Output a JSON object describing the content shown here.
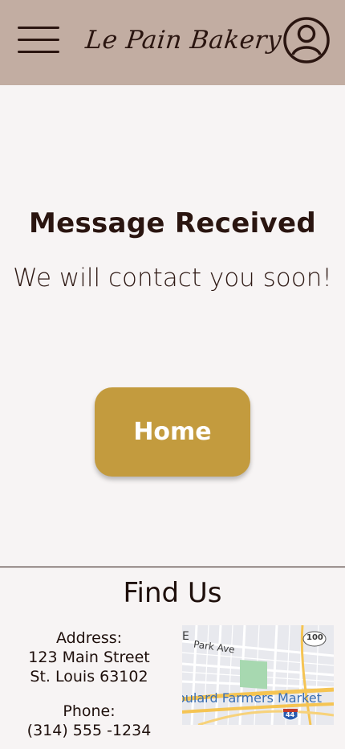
{
  "header": {
    "brand": "Le Pain Bakery",
    "menu_icon": "hamburger-icon",
    "profile_icon": "user-circle-icon",
    "background": "#c2ada2"
  },
  "main": {
    "title": "Message Received",
    "subtitle": "We will contact you soon!",
    "home_button": "Home",
    "accent": "#c39b3e"
  },
  "footer": {
    "title": "Find Us",
    "address_label": "Address:",
    "address_line1": "123 Main Street",
    "address_line2": "St. Louis 63102",
    "phone_label": "Phone:",
    "phone": "(314) 555 -1234",
    "map": {
      "street_label": "Park Ave",
      "route_badge": "100",
      "place_label": "oulard Farmers Market",
      "interstate_badge": "44",
      "partial_label": "E"
    }
  }
}
